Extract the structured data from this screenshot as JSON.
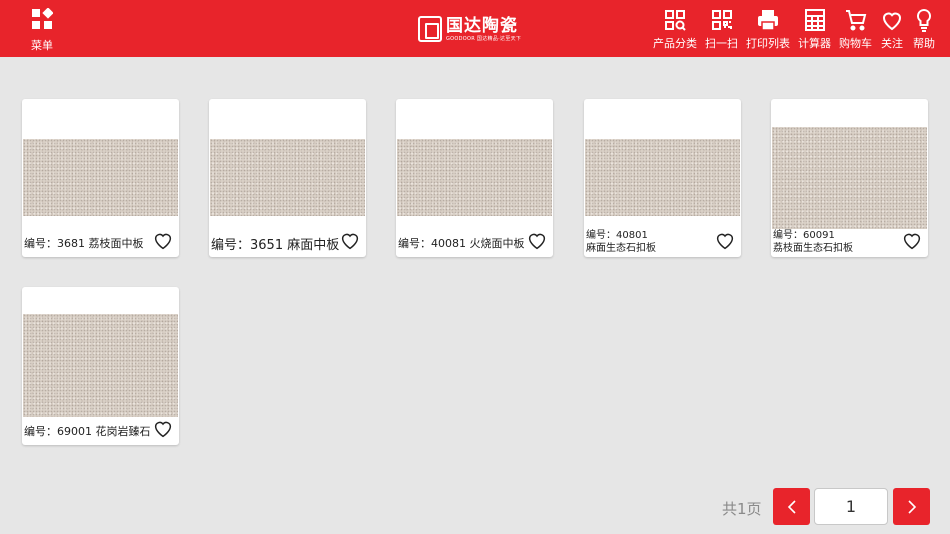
{
  "header": {
    "menu_label": "菜单",
    "brand_name": "国达陶瓷",
    "brand_sub": "GOODOOR 国达精品·达至天下",
    "bg_color": "#e8242b",
    "nav": [
      {
        "label": "产品分类",
        "icon": "product-category-icon"
      },
      {
        "label": "扫一扫",
        "icon": "qr-scan-icon"
      },
      {
        "label": "打印列表",
        "icon": "printer-icon"
      },
      {
        "label": "计算器",
        "icon": "calculator-icon"
      },
      {
        "label": "购物车",
        "icon": "shopping-cart-icon"
      },
      {
        "label": "关注",
        "icon": "heart-icon"
      },
      {
        "label": "帮助",
        "icon": "lightbulb-icon"
      }
    ]
  },
  "products": [
    {
      "line1": "编号：3681 荔枝面中板",
      "line2": "",
      "favorited": false
    },
    {
      "line1": "编号：3651 麻面中板",
      "line2": "",
      "favorited": false
    },
    {
      "line1": "编号：40081 火烧面中板",
      "line2": "",
      "favorited": false
    },
    {
      "line1": "编号：40801",
      "line2": "麻面生态石扣板",
      "favorited": false
    },
    {
      "line1": "编号：60091",
      "line2": "荔枝面生态石扣板",
      "favorited": false
    },
    {
      "line1": "编号：69001 花岗岩臻石",
      "line2": "",
      "favorited": false
    }
  ],
  "pagination": {
    "total_pages_label": "共1页",
    "current_page": "1"
  }
}
